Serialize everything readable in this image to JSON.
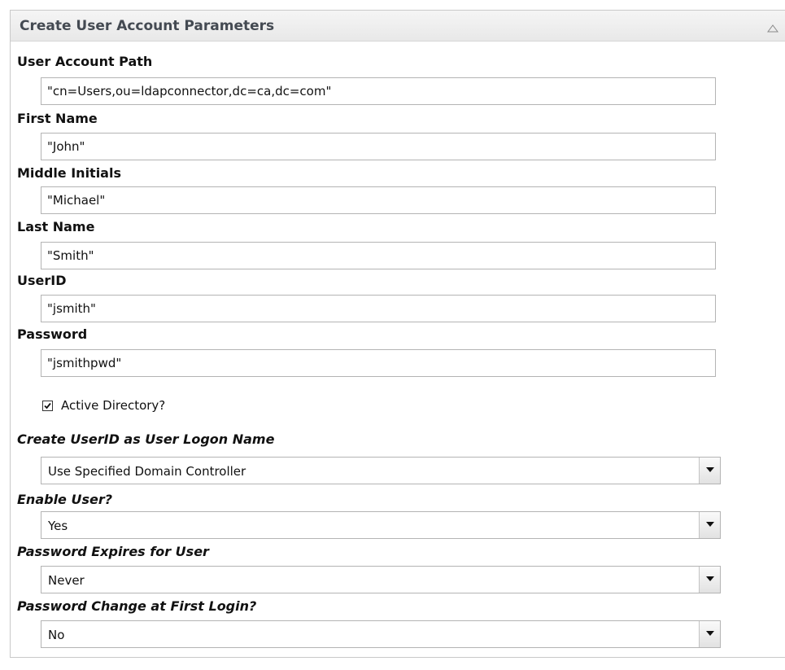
{
  "panel": {
    "title": "Create User Account Parameters",
    "collapse_icon": "collapse-up-icon"
  },
  "fields": {
    "user_account_path": {
      "label": "User Account Path",
      "value": "\"cn=Users,ou=ldapconnector,dc=ca,dc=com\""
    },
    "first_name": {
      "label": "First Name",
      "value": "\"John\""
    },
    "middle_initials": {
      "label": "Middle Initials",
      "value": "\"Michael\""
    },
    "last_name": {
      "label": "Last Name",
      "value": "\"Smith\""
    },
    "user_id": {
      "label": "UserID",
      "value": "\"jsmith\""
    },
    "password": {
      "label": "Password",
      "value": "\"jsmithpwd\""
    }
  },
  "active_directory": {
    "label": "Active Directory?",
    "checked": true
  },
  "selects": {
    "create_userid_logon": {
      "label": "Create UserID as User Logon Name",
      "value": "Use Specified Domain Controller"
    },
    "enable_user": {
      "label": "Enable User?",
      "value": "Yes"
    },
    "password_expires": {
      "label": "Password Expires for User",
      "value": "Never"
    },
    "password_change_first_login": {
      "label": "Password Change at First Login?",
      "value": "No"
    }
  }
}
